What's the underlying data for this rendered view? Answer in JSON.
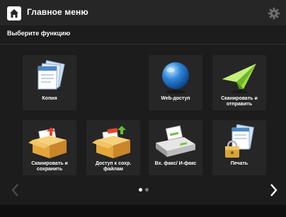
{
  "header": {
    "title": "Главное меню",
    "home_icon": "home-icon",
    "settings_icon": "gear-icon"
  },
  "subheader": {
    "label": "Выберите функцию"
  },
  "tiles": [
    {
      "label": "Копия",
      "icon": "copy-icon"
    },
    {
      "label": "Web-доступ",
      "icon": "globe-icon"
    },
    {
      "label": "Сканировать и отправить",
      "icon": "paper-plane-icon"
    },
    {
      "label": "Сканировать и сохранить",
      "icon": "scan-box-icon"
    },
    {
      "label": "Доступ к сохр. файлам",
      "icon": "stored-files-icon"
    },
    {
      "label": "Вх. факс/ И-факс",
      "icon": "fax-icon"
    },
    {
      "label": "Печать",
      "icon": "secure-print-icon"
    }
  ],
  "pagination": {
    "pages": 2,
    "current": 1
  },
  "colors": {
    "background": "#1c1c1c",
    "tile": "#262626",
    "text": "#ffffff"
  }
}
